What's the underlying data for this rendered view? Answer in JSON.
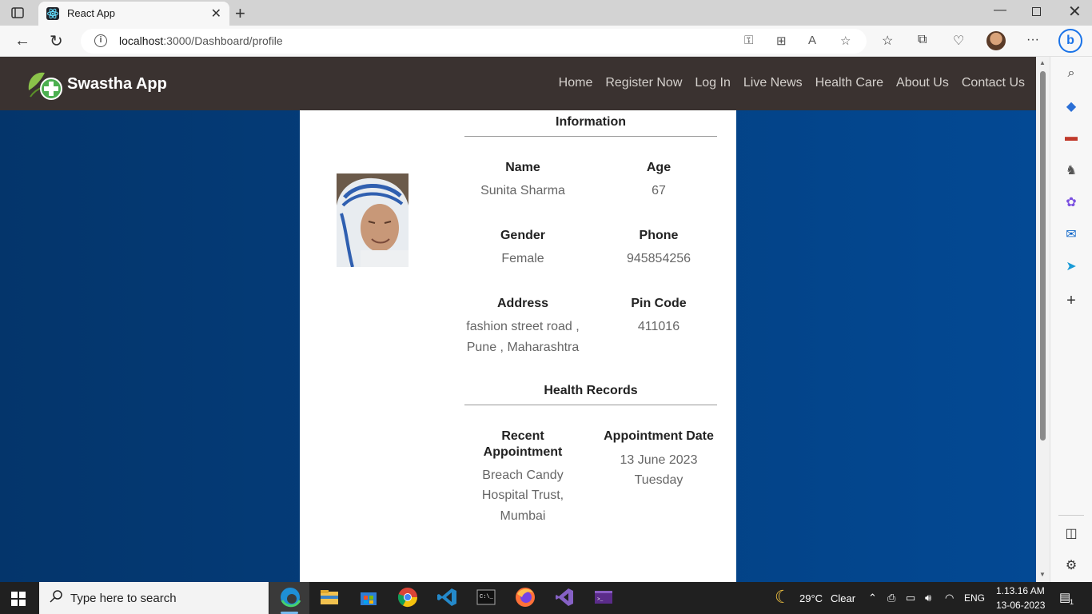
{
  "browser": {
    "tab_title": "React App",
    "url_host": "localhost",
    "url_rest": ":3000/Dashboard/profile"
  },
  "navbar": {
    "brand": "Swastha App",
    "links": [
      "Home",
      "Register Now",
      "Log In",
      "Live News",
      "Health Care",
      "About Us",
      "Contact Us"
    ]
  },
  "profile": {
    "information_title": "Information",
    "name_label": "Name",
    "name_value": "Sunita Sharma",
    "age_label": "Age",
    "age_value": "67",
    "gender_label": "Gender",
    "gender_value": "Female",
    "phone_label": "Phone",
    "phone_value": "945854256",
    "address_label": "Address",
    "address_value_line1": "fashion street road ,",
    "address_value_line2": "Pune , Maharashtra",
    "pincode_label": "Pin Code",
    "pincode_value": "411016",
    "health_title": "Health Records",
    "recent_label_line1": "Recent",
    "recent_label_line2": "Appointment",
    "recent_value_line1": "Breach Candy",
    "recent_value_line2": "Hospital Trust,",
    "recent_value_line3": "Mumbai",
    "date_label": "Appointment Date",
    "date_value_line1": "13 June 2023",
    "date_value_line2": "Tuesday"
  },
  "taskbar": {
    "search_placeholder": "Type here to search",
    "weather_temp": "29°C",
    "weather_desc": "Clear",
    "language": "ENG",
    "time": "1.13.16 AM",
    "date": "13-06-2023",
    "notification_count": "1"
  },
  "colors": {
    "navbar_bg": "#3a3230",
    "page_bg_left": "#04356b",
    "page_bg_right": "#034994",
    "taskbar_bg": "#202020"
  }
}
